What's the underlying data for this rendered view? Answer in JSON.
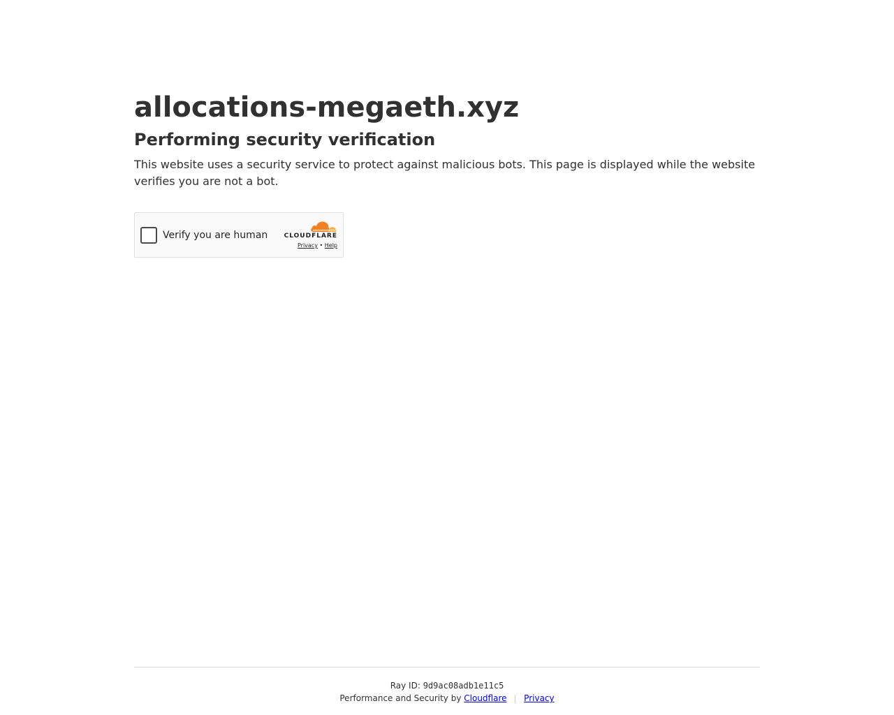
{
  "main": {
    "site_title": "allocations-megaeth.xyz",
    "subtitle": "Performing security verification",
    "description": "This website uses a security service to protect against malicious bots. This page is displayed while the website verifies you are not a bot."
  },
  "widget": {
    "verify_label": "Verify you are human",
    "brand": "CLOUDFLARE",
    "privacy_link": "Privacy",
    "link_separator": "•",
    "help_link": "Help",
    "icon": "cloudflare-cloud-icon",
    "brand_colors": {
      "orange": "#f38020",
      "light_orange": "#faae40"
    }
  },
  "footer": {
    "ray_label": "Ray ID:",
    "ray_id": "9d9ac08adb1e11c5",
    "perf_text": "Performance and Security by",
    "cloudflare_link": "Cloudflare",
    "privacy_link": "Privacy"
  }
}
